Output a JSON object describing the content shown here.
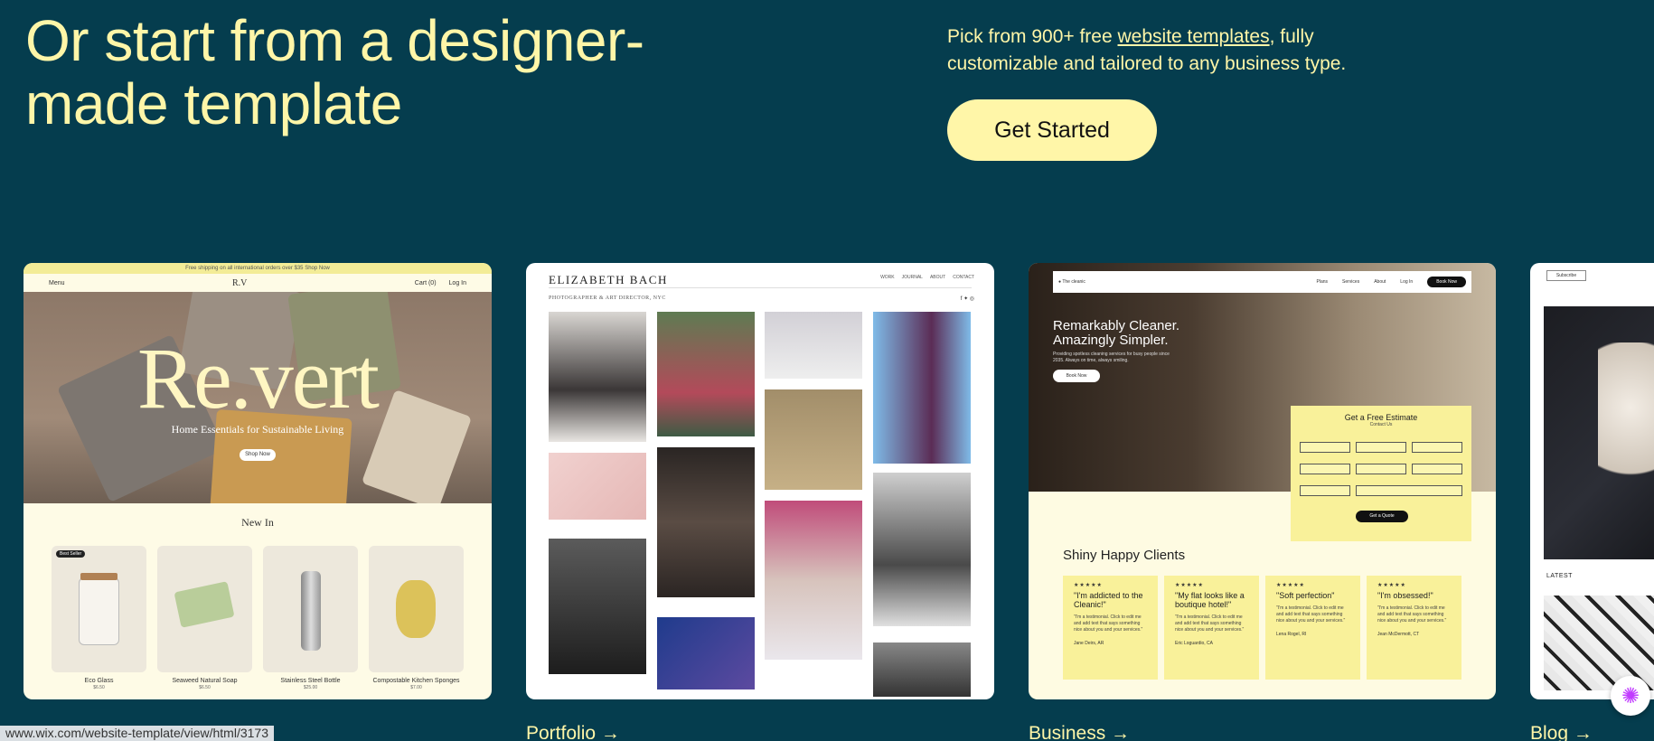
{
  "hero": {
    "headline": "Or start from a designer-made template",
    "intro_before": "Pick from 900+ free ",
    "intro_link": "website templates",
    "intro_after": ", fully customizable and tailored to any business type.",
    "cta": "Get Started"
  },
  "cards": {
    "revert": {
      "promo": "Free shipping on all international orders over $35 Shop Now",
      "menu": "Menu",
      "logo": "R.V",
      "cart": "Cart (0)",
      "login": "Log In",
      "title": "Re.vert",
      "subtitle": "Home Essentials for Sustainable Living",
      "shop": "Shop Now",
      "section": "New In",
      "products": [
        {
          "name": "Eco Glass",
          "price": "$6.50",
          "badge": "Best Seller"
        },
        {
          "name": "Seaweed Natural Soap",
          "price": "$6.50"
        },
        {
          "name": "Stainless Steel Bottle",
          "price": "$25.00"
        },
        {
          "name": "Compostable Kitchen Sponges",
          "price": "$7.00"
        }
      ]
    },
    "portfolio": {
      "name": "ELIZABETH BACH",
      "subtitle": "PHOTOGRAPHER & ART DIRECTOR, NYC",
      "nav": [
        "WORK",
        "JOURNAL",
        "ABOUT",
        "CONTACT"
      ],
      "social": "f ✦ ◎"
    },
    "business": {
      "brand": "● The cleanic",
      "nav": [
        "Plans",
        "Services",
        "About",
        "Log In"
      ],
      "book": "Book Now",
      "headline_1": "Remarkably Cleaner.",
      "headline_2": "Amazingly Simpler.",
      "text": "Providing spotless cleaning services for busy people since 2035. Always on time, always smiling.",
      "hero_button": "Book Now",
      "form_title": "Get a Free Estimate",
      "form_sub": "Contact Us",
      "form_button": "Get a Quote",
      "clients_title": "Shiny Happy Clients",
      "testimonials": [
        {
          "stars": "★★★★★",
          "quote": "\"I'm addicted to the Cleanic!\"",
          "body": "\"I'm a testimonial. Click to edit me and add text that says something nice about you and your services.\"",
          "name": "Jane Deirs, AR"
        },
        {
          "stars": "★★★★★",
          "quote": "\"My flat looks like a boutique hotel!\"",
          "body": "\"I'm a testimonial. Click to edit me and add text that says something nice about you and your services.\"",
          "name": "Eric Loguardio, CA"
        },
        {
          "stars": "★★★★★",
          "quote": "\"Soft perfection\"",
          "body": "\"I'm a testimonial. Click to edit me and add text that says something nice about you and your services.\"",
          "name": "Lena Rogel, RI"
        },
        {
          "stars": "★★★★★",
          "quote": "\"I'm obsessed!\"",
          "body": "\"I'm a testimonial. Click to edit me and add text that says something nice about you and your services.\"",
          "name": "Jean McDermott, CT"
        }
      ]
    },
    "blog": {
      "subscribe": "Subscribe",
      "latest": "LATEST"
    }
  },
  "categories": [
    "Portfolio →",
    "Business →",
    "Blog →"
  ],
  "status_url": "www.wix.com/website-template/view/html/3173",
  "colors": {
    "background": "#053d4e",
    "accent": "#fff6a8"
  }
}
